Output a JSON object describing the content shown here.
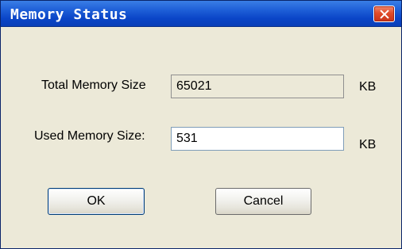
{
  "window": {
    "title": "Memory Status",
    "close_label": "×"
  },
  "form": {
    "total": {
      "label": "Total Memory Size",
      "value": "65021",
      "unit": "KB"
    },
    "used": {
      "label": "Used Memory Size:",
      "value": "531",
      "unit": "KB"
    }
  },
  "buttons": {
    "ok": "OK",
    "cancel": "Cancel"
  },
  "icons": {
    "close": "close-icon"
  }
}
